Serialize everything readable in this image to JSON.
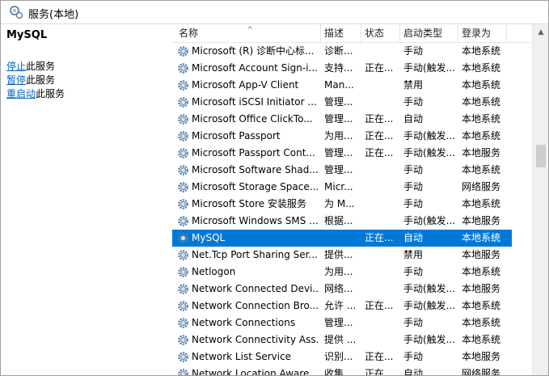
{
  "window": {
    "title": "服务(本地)"
  },
  "sidebar": {
    "service_name": "MySQL",
    "actions": [
      {
        "link": "停止",
        "rest": "此服务"
      },
      {
        "link": "暂停",
        "rest": "此服务"
      },
      {
        "link": "重启动",
        "rest": "此服务"
      }
    ]
  },
  "columns": {
    "name": "名称",
    "description": "描述",
    "status": "状态",
    "startup": "启动类型",
    "logon": "登录为",
    "sort_indicator": "^"
  },
  "rows": [
    {
      "name": "Microsoft (R) 诊断中心标...",
      "description": "诊断...",
      "status": "",
      "startup": "手动",
      "logon": "本地系统"
    },
    {
      "name": "Microsoft Account Sign-i...",
      "description": "支持...",
      "status": "正在...",
      "startup": "手动(触发...",
      "logon": "本地系统"
    },
    {
      "name": "Microsoft App-V Client",
      "description": "Man...",
      "status": "",
      "startup": "禁用",
      "logon": "本地系统"
    },
    {
      "name": "Microsoft iSCSI Initiator ...",
      "description": "管理...",
      "status": "",
      "startup": "手动",
      "logon": "本地系统"
    },
    {
      "name": "Microsoft Office ClickTo...",
      "description": "管理...",
      "status": "正在...",
      "startup": "自动",
      "logon": "本地系统"
    },
    {
      "name": "Microsoft Passport",
      "description": "为用...",
      "status": "正在...",
      "startup": "手动(触发...",
      "logon": "本地系统"
    },
    {
      "name": "Microsoft Passport Cont...",
      "description": "管理...",
      "status": "正在...",
      "startup": "手动(触发...",
      "logon": "本地服务"
    },
    {
      "name": "Microsoft Software Shad...",
      "description": "管理...",
      "status": "",
      "startup": "手动",
      "logon": "本地系统"
    },
    {
      "name": "Microsoft Storage Space...",
      "description": "Micr...",
      "status": "",
      "startup": "手动",
      "logon": "网络服务"
    },
    {
      "name": "Microsoft Store 安装服务",
      "description": "为 M...",
      "status": "",
      "startup": "手动",
      "logon": "本地系统"
    },
    {
      "name": "Microsoft Windows SMS ...",
      "description": "根据...",
      "status": "",
      "startup": "手动(触发...",
      "logon": "本地服务"
    },
    {
      "name": "MySQL",
      "description": "",
      "status": "正在...",
      "startup": "自动",
      "logon": "本地系统",
      "selected": true
    },
    {
      "name": "Net.Tcp Port Sharing Ser...",
      "description": "提供...",
      "status": "",
      "startup": "禁用",
      "logon": "本地服务"
    },
    {
      "name": "Netlogon",
      "description": "为用...",
      "status": "",
      "startup": "手动",
      "logon": "本地系统"
    },
    {
      "name": "Network Connected Devi...",
      "description": "网络...",
      "status": "",
      "startup": "手动(触发...",
      "logon": "本地服务"
    },
    {
      "name": "Network Connection Bro...",
      "description": "允许 ...",
      "status": "正在...",
      "startup": "手动(触发...",
      "logon": "本地系统"
    },
    {
      "name": "Network Connections",
      "description": "管理...",
      "status": "",
      "startup": "手动",
      "logon": "本地系统"
    },
    {
      "name": "Network Connectivity Ass...",
      "description": "提供 ...",
      "status": "",
      "startup": "手动(触发...",
      "logon": "本地系统"
    },
    {
      "name": "Network List Service",
      "description": "识别...",
      "status": "正在...",
      "startup": "手动",
      "logon": "本地服务"
    },
    {
      "name": "Network Location Aware...",
      "description": "收集...",
      "status": "正在...",
      "startup": "自动",
      "logon": "网络服务"
    }
  ],
  "colors": {
    "selection": "#0078d7",
    "link": "#0066cc"
  }
}
